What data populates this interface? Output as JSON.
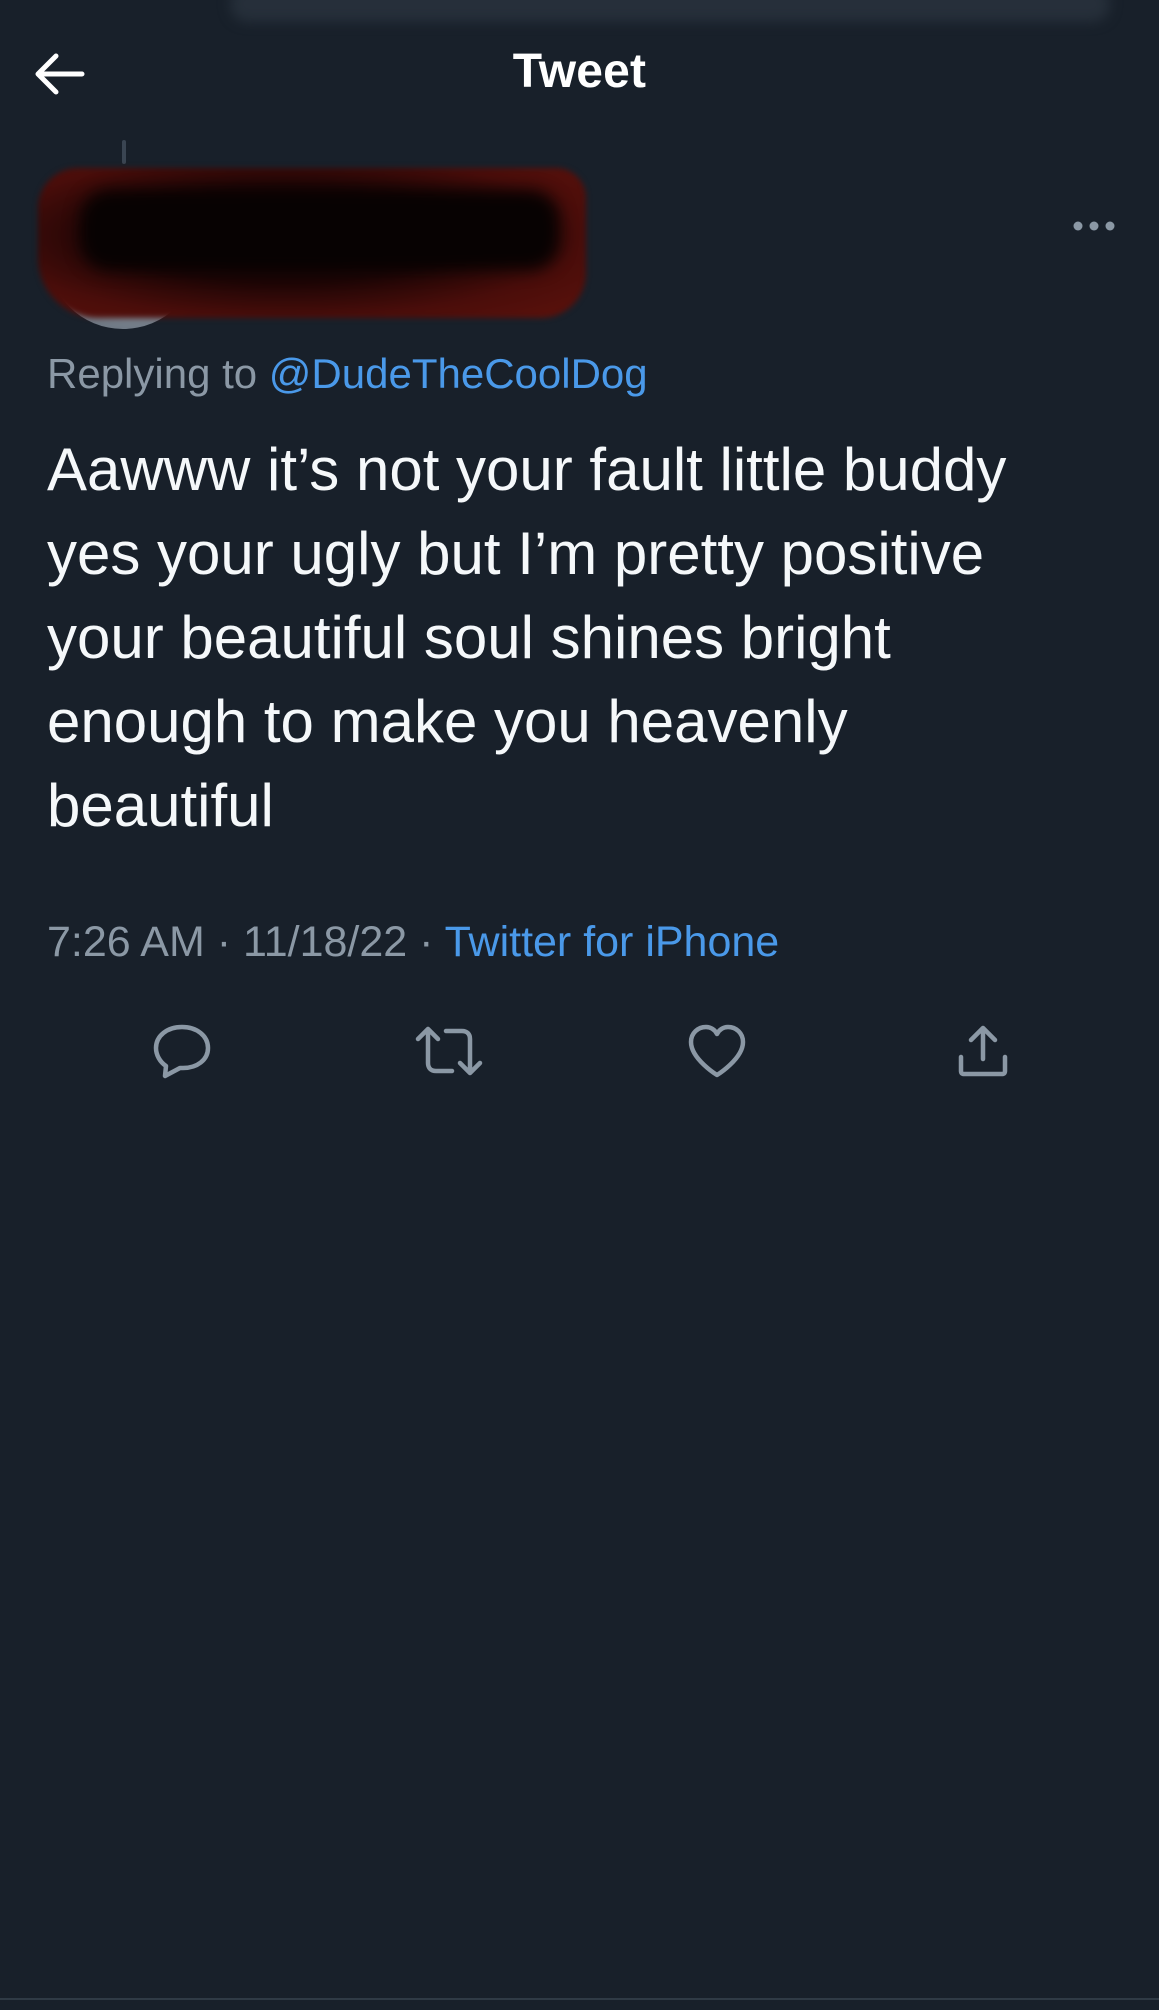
{
  "header": {
    "title": "Tweet"
  },
  "tweet": {
    "replying_prefix": "Replying to ",
    "replying_handle": "@DudeTheCoolDog",
    "text": "Aawww it’s not your fault little buddy\nyes your ugly but I’m pretty positive\nyour beautiful soul shines bright\nenough to make you heavenly\nbeautiful",
    "time": "7:26 AM",
    "separator": " · ",
    "date": "11/18/22",
    "source": "Twitter for iPhone"
  },
  "icons": {
    "back": "back-arrow-icon",
    "more": "more-options-icon",
    "reply": "reply-icon",
    "retweet": "retweet-icon",
    "like": "like-icon",
    "share": "share-icon"
  },
  "colors": {
    "background": "#18202a",
    "link": "#4a99e9",
    "secondary_text": "#8b98a5",
    "primary_text": "#f5f8fa",
    "icon": "#8b98a5",
    "redaction": "#4a0d0a"
  }
}
